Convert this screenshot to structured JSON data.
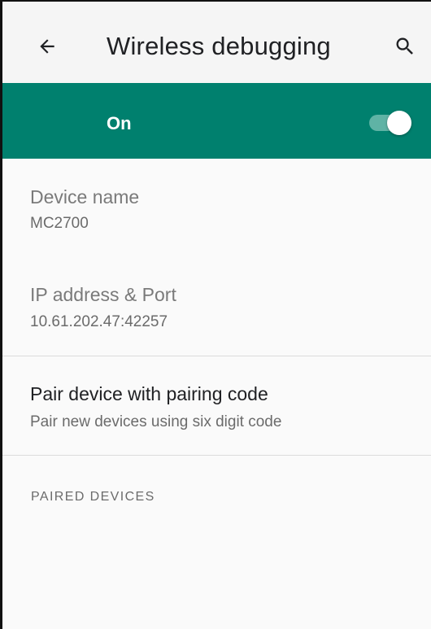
{
  "appbar": {
    "title": "Wireless debugging",
    "back_icon": "arrow-left-icon",
    "search_icon": "search-icon"
  },
  "master_switch": {
    "label": "On",
    "checked": true,
    "background_color": "#00806e"
  },
  "device_name": {
    "title": "Device name",
    "summary": "MC2700"
  },
  "ip_address": {
    "title": "IP address & Port",
    "summary": "10.61.202.47:42257"
  },
  "pairing_code": {
    "title": "Pair device with pairing code",
    "summary": "Pair new devices using six digit code"
  },
  "paired_devices": {
    "header": "PAIRED DEVICES"
  }
}
